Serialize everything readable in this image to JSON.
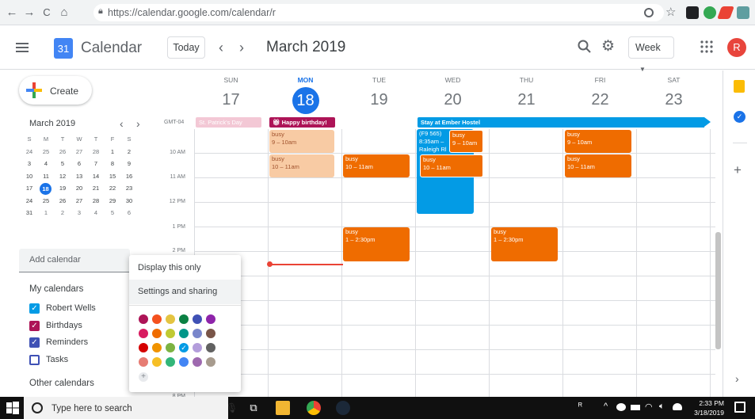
{
  "browser": {
    "url": "https://calendar.google.com/calendar/r",
    "back": "←",
    "forward": "→",
    "reload": "C",
    "home": "⌂"
  },
  "header": {
    "app_title": "Calendar",
    "logo_day": "31",
    "today_label": "Today",
    "prev": "‹",
    "next": "›",
    "month_title": "March 2019",
    "view_label": "Week",
    "avatar_letter": "R"
  },
  "sidebar": {
    "create_label": "Create",
    "mini_title": "March 2019",
    "mini_prev": "‹",
    "mini_next": "›",
    "weekday_initials": [
      "S",
      "M",
      "T",
      "W",
      "T",
      "F",
      "S"
    ],
    "mini_weeks": [
      [
        "24",
        "25",
        "26",
        "27",
        "28",
        "1",
        "2"
      ],
      [
        "3",
        "4",
        "5",
        "6",
        "7",
        "8",
        "9"
      ],
      [
        "10",
        "11",
        "12",
        "13",
        "14",
        "15",
        "16"
      ],
      [
        "17",
        "18",
        "19",
        "20",
        "21",
        "22",
        "23"
      ],
      [
        "24",
        "25",
        "26",
        "27",
        "28",
        "29",
        "30"
      ],
      [
        "31",
        "1",
        "2",
        "3",
        "4",
        "5",
        "6"
      ]
    ],
    "add_calendar_placeholder": "Add calendar",
    "my_calendars_heading": "My calendars",
    "my_calendars": [
      {
        "label": "Robert Wells",
        "checked": true,
        "color": "#039be5"
      },
      {
        "label": "Birthdays",
        "checked": true,
        "color": "#ad1457"
      },
      {
        "label": "Reminders",
        "checked": true,
        "color": "#3f51b5"
      },
      {
        "label": "Tasks",
        "checked": false,
        "color": "#3f51b5"
      }
    ],
    "other_calendars_heading": "Other calendars"
  },
  "week": {
    "timezone": "GMT-04",
    "days": [
      {
        "name": "SUN",
        "num": "17"
      },
      {
        "name": "MON",
        "num": "18",
        "today": true
      },
      {
        "name": "TUE",
        "num": "19"
      },
      {
        "name": "WED",
        "num": "20"
      },
      {
        "name": "THU",
        "num": "21"
      },
      {
        "name": "FRI",
        "num": "22"
      },
      {
        "name": "SAT",
        "num": "23"
      }
    ],
    "time_labels": [
      "10 AM",
      "11 AM",
      "12 PM",
      "1 PM",
      "2 PM",
      "8 PM"
    ],
    "all_day": {
      "st_patricks": "St. Patrick's Day",
      "birthday": "Happy birthday!",
      "hostel": "Stay at Ember Hostel"
    },
    "events": {
      "busy_title": "busy",
      "mon_9": "9 – 10am",
      "mon_10": "10 – 11am",
      "tue_10": "10 – 11am",
      "tue_1": "1 – 2:30pm",
      "wed_flight_l1": "(F9 565)",
      "wed_flight_l2": "8:35am –",
      "wed_flight_l3": "Raleigh Rl",
      "wed_9": "9 – 10am",
      "wed_10": "10 – 11am",
      "thu_1": "1 – 2:30pm",
      "fri_9": "9 – 10am",
      "fri_10": "10 – 11am"
    }
  },
  "context_menu": {
    "items": [
      "Display this only",
      "Settings and sharing"
    ],
    "colors": [
      [
        "#ad1457",
        "#f4511e",
        "#e4c441",
        "#0b8043",
        "#3f51b5",
        "#8e24aa"
      ],
      [
        "#d81b60",
        "#ef6c00",
        "#c0ca33",
        "#009688",
        "#7986cb",
        "#795548"
      ],
      [
        "#d50000",
        "#f09300",
        "#7cb342",
        "#039be5",
        "#b39ddb",
        "#616161"
      ],
      [
        "#e67c73",
        "#f6bf26",
        "#33b679",
        "#4285f4",
        "#9e69af",
        "#a79b8e"
      ]
    ],
    "selected_color": "#039be5",
    "add_color": "+"
  },
  "taskbar": {
    "search_placeholder": "Type here to search",
    "time": "2:33 PM",
    "date": "3/18/2019"
  },
  "colors": {
    "accent": "#1a73e8",
    "event_orange": "#ef6c00",
    "event_peach": "#f8cba4",
    "now_line": "#ea4335"
  }
}
